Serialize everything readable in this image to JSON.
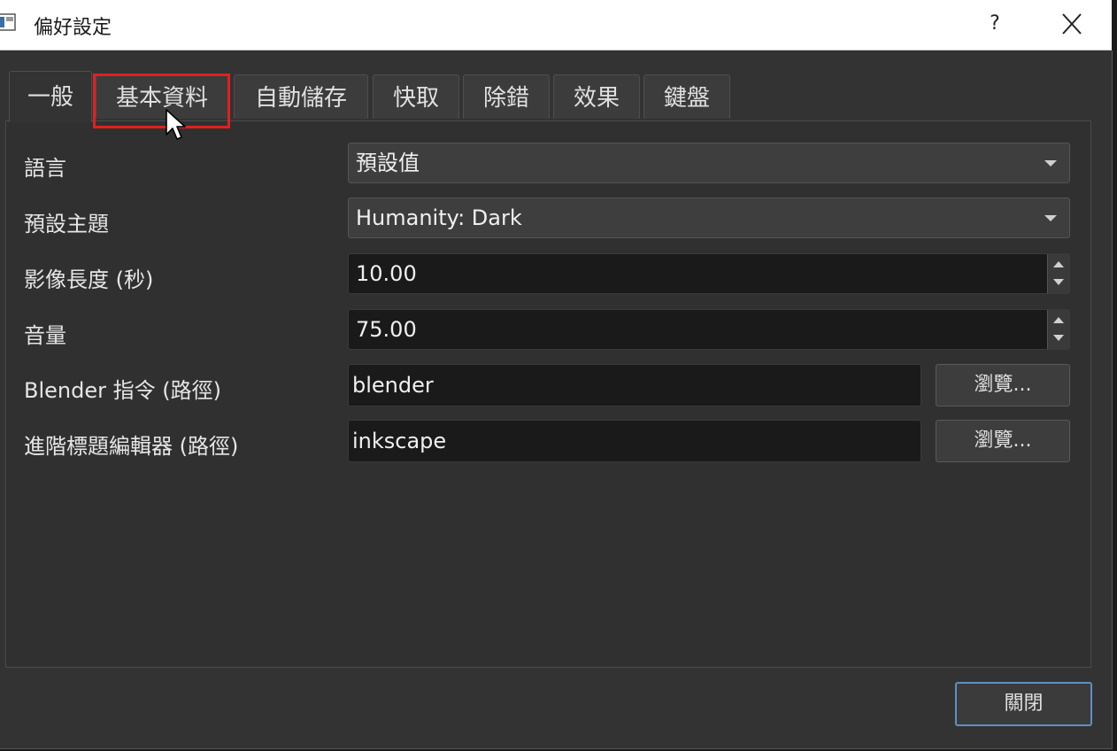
{
  "window": {
    "title": "偏好設定",
    "help": "?",
    "close_icon": "close-icon"
  },
  "tabs": [
    {
      "label": "一般",
      "active": true
    },
    {
      "label": "基本資料",
      "active": false
    },
    {
      "label": "自動儲存",
      "active": false
    },
    {
      "label": "快取",
      "active": false
    },
    {
      "label": "除錯",
      "active": false
    },
    {
      "label": "效果",
      "active": false
    },
    {
      "label": "鍵盤",
      "active": false
    }
  ],
  "settings": {
    "language": {
      "label": "語言",
      "value": "預設值"
    },
    "theme": {
      "label": "預設主題",
      "value": "Humanity: Dark"
    },
    "image_length": {
      "label": "影像長度 (秒)",
      "value": "10.00"
    },
    "volume": {
      "label": "音量",
      "value": "75.00"
    },
    "blender": {
      "label": "Blender 指令 (路徑)",
      "value": "blender",
      "browse": "瀏覽..."
    },
    "title_editor": {
      "label": "進階標題編輯器 (路徑)",
      "value": "inkscape",
      "browse": "瀏覽..."
    }
  },
  "footer": {
    "close_label": "關閉"
  },
  "colors": {
    "highlight": "#e02020",
    "accent": "#5e8fc4"
  }
}
